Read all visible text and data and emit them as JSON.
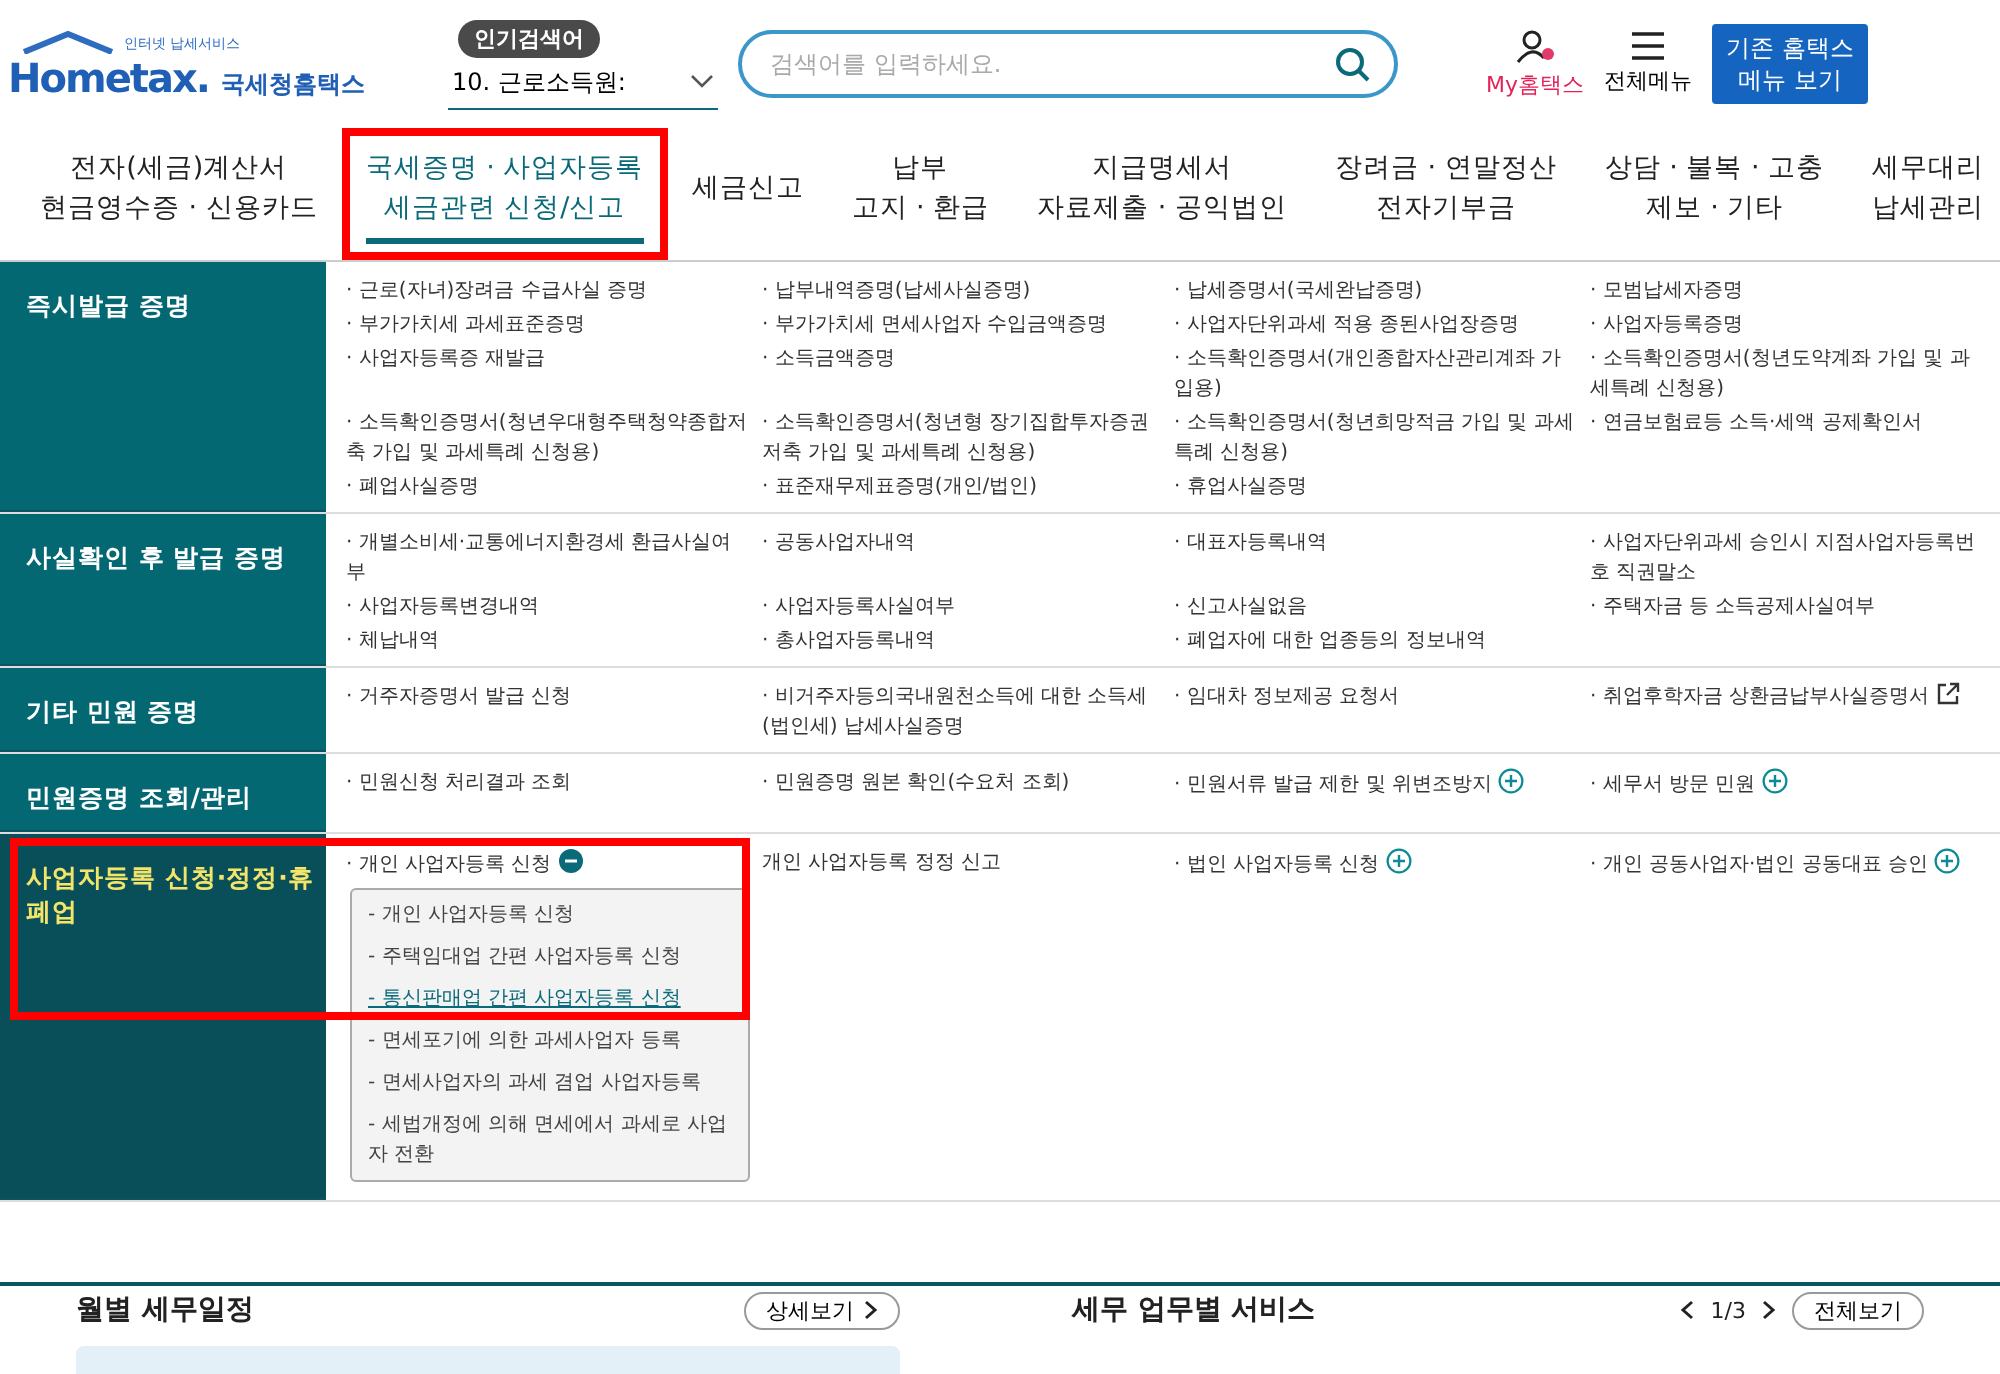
{
  "header": {
    "logo": {
      "tagline": "인터넷 납세서비스",
      "brand": "Hometax.",
      "name": "국세청홈택스"
    },
    "popular_label": "인기검색어",
    "popular_select": "10. 근로소득원:",
    "search": {
      "placeholder": "검색어를 입력하세요."
    },
    "my_hometax": "My홈택스",
    "all_menu": "전체메뉴",
    "old_menu_button": "기존 홈택스 메뉴 보기"
  },
  "nav": [
    {
      "lines": [
        "전자(세금)계산서",
        "현금영수증 · 신용카드"
      ],
      "selected": false,
      "highlighted": false
    },
    {
      "lines": [
        "국세증명 · 사업자등록",
        "세금관련 신청/신고"
      ],
      "selected": true,
      "highlighted": true
    },
    {
      "lines": [
        "세금신고"
      ],
      "selected": false,
      "highlighted": false
    },
    {
      "lines": [
        "납부",
        "고지 · 환급"
      ],
      "selected": false,
      "highlighted": false
    },
    {
      "lines": [
        "지급명세서",
        "자료제출 · 공익법인"
      ],
      "selected": false,
      "highlighted": false
    },
    {
      "lines": [
        "장려금 · 연말정산",
        "전자기부금"
      ],
      "selected": false,
      "highlighted": false
    },
    {
      "lines": [
        "상담 · 불복 · 고충",
        "제보 · 기타"
      ],
      "selected": false,
      "highlighted": false
    },
    {
      "lines": [
        "세무대리",
        "납세관리"
      ],
      "selected": false,
      "highlighted": false
    }
  ],
  "sections": [
    {
      "title": "즉시발급 증명",
      "selected": false,
      "highlighted": false,
      "items": [
        {
          "text": "· 근로(자녀)장려금 수급사실 증명",
          "kind": "link"
        },
        {
          "text": "· 납부내역증명(납세사실증명)",
          "kind": "link"
        },
        {
          "text": "· 납세증명서(국세완납증명)",
          "kind": "link"
        },
        {
          "text": "· 모범납세자증명",
          "kind": "link"
        },
        {
          "text": "· 부가가치세 과세표준증명",
          "kind": "link"
        },
        {
          "text": "· 부가가치세 면세사업자 수입금액증명",
          "kind": "link"
        },
        {
          "text": "· 사업자단위과세 적용 종된사업장증명",
          "kind": "link"
        },
        {
          "text": "· 사업자등록증명",
          "kind": "link"
        },
        {
          "text": "· 사업자등록증 재발급",
          "kind": "link"
        },
        {
          "text": "· 소득금액증명",
          "kind": "link"
        },
        {
          "text": "· 소득확인증명서(개인종합자산관리계좌 가입용)",
          "kind": "link"
        },
        {
          "text": "· 소득확인증명서(청년도약계좌 가입 및 과세특례 신청용)",
          "kind": "link"
        },
        {
          "text": "· 소득확인증명서(청년우대형주택청약종합저축 가입 및 과세특례 신청용)",
          "kind": "link"
        },
        {
          "text": "· 소득확인증명서(청년형 장기집합투자증권저축 가입 및 과세특례 신청용)",
          "kind": "link"
        },
        {
          "text": "· 소득확인증명서(청년희망적금 가입 및 과세특례 신청용)",
          "kind": "link"
        },
        {
          "text": "· 연금보험료등 소득·세액 공제확인서",
          "kind": "link"
        },
        {
          "text": "· 폐업사실증명",
          "kind": "link"
        },
        {
          "text": "· 표준재무제표증명(개인/법인)",
          "kind": "link"
        },
        {
          "text": "· 휴업사실증명",
          "kind": "link"
        }
      ]
    },
    {
      "title": "사실확인 후 발급 증명",
      "selected": false,
      "highlighted": false,
      "items": [
        {
          "text": "· 개별소비세·교통에너지환경세 환급사실여부",
          "kind": "link"
        },
        {
          "text": "· 공동사업자내역",
          "kind": "link"
        },
        {
          "text": "· 대표자등록내역",
          "kind": "link"
        },
        {
          "text": "· 사업자단위과세 승인시 지점사업자등록번호 직권말소",
          "kind": "link"
        },
        {
          "text": "· 사업자등록변경내역",
          "kind": "link"
        },
        {
          "text": "· 사업자등록사실여부",
          "kind": "link"
        },
        {
          "text": "· 신고사실없음",
          "kind": "link"
        },
        {
          "text": "· 주택자금 등 소득공제사실여부",
          "kind": "link"
        },
        {
          "text": "· 체납내역",
          "kind": "link"
        },
        {
          "text": "· 총사업자등록내역",
          "kind": "link"
        },
        {
          "text": "· 폐업자에 대한 업종등의 정보내역",
          "kind": "link"
        }
      ]
    },
    {
      "title": "기타 민원 증명",
      "selected": false,
      "highlighted": false,
      "items": [
        {
          "text": "· 거주자증명서 발급 신청",
          "kind": "link"
        },
        {
          "text": "· 비거주자등의국내원천소득에 대한 소득세(법인세) 납세사실증명",
          "kind": "link"
        },
        {
          "text": "· 임대차 정보제공 요청서",
          "kind": "link"
        },
        {
          "text": "· 취업후학자금 상환금납부사실증명서",
          "kind": "external"
        }
      ]
    },
    {
      "title": "민원증명 조회/관리",
      "selected": false,
      "highlighted": false,
      "items": [
        {
          "text": "· 민원신청 처리결과 조회",
          "kind": "link"
        },
        {
          "text": "· 민원증명 원본 확인(수요처 조회)",
          "kind": "link"
        },
        {
          "text": "· 민원서류 발급 제한 및 위변조방지",
          "kind": "expandable"
        },
        {
          "text": "· 세무서 방문 민원",
          "kind": "expandable"
        }
      ]
    },
    {
      "title": "사업자등록 신청·정정·휴폐업",
      "selected": true,
      "highlighted": true,
      "items": [
        {
          "text": "· 개인 사업자등록 신청",
          "kind": "expanded",
          "children": [
            {
              "text": "- 개인 사업자등록 신청",
              "selected": false
            },
            {
              "text": "- 주택임대업 간편 사업자등록 신청",
              "selected": false
            },
            {
              "text": "- 통신판매업 간편 사업자등록 신청",
              "selected": true
            },
            {
              "text": "- 면세포기에 의한 과세사업자 등록",
              "selected": false
            },
            {
              "text": "- 면세사업자의 과세 겸업 사업자등록",
              "selected": false
            },
            {
              "text": "- 세법개정에 의해 면세에서 과세로 사업자 전환",
              "selected": false
            }
          ]
        },
        {
          "text": "개인 사업자등록 정정 신고",
          "kind": "link"
        },
        {
          "text": "· 법인 사업자등록 신청",
          "kind": "expandable"
        },
        {
          "text": "· 개인 공동사업자·법인 공동대표 승인",
          "kind": "expandable"
        }
      ]
    }
  ],
  "below": {
    "schedule_title": "월별 세무일정",
    "detail_button": "상세보기",
    "services_title": "세무 업무별 서비스",
    "pager": "1/3",
    "all_button": "전체보기"
  }
}
